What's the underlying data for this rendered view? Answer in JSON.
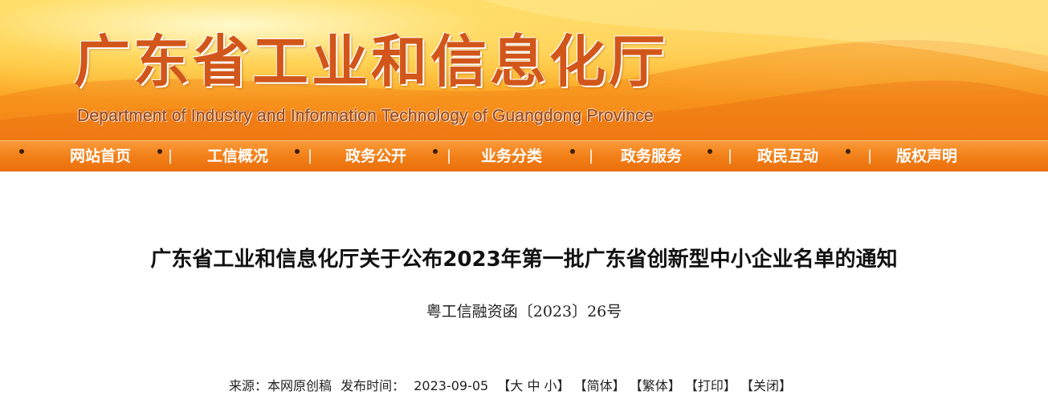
{
  "header": {
    "title_cn": "广东省工业和信息化厅",
    "title_en": "Department of Industry and Information Technology of Guangdong Province"
  },
  "nav": {
    "items": [
      {
        "label": "网站首页"
      },
      {
        "label": "工信概况"
      },
      {
        "label": "政务公开"
      },
      {
        "label": "业务分类"
      },
      {
        "label": "政务服务"
      },
      {
        "label": "政民互动"
      },
      {
        "label": "版权声明"
      }
    ],
    "separator": "|"
  },
  "article": {
    "title": "广东省工业和信息化厅关于公布2023年第一批广东省创新型中小企业名单的通知",
    "doc_number": "粤工信融资函〔2023〕26号",
    "meta": {
      "source_label": "来源：",
      "source_value": "本网原创稿",
      "date_label": "发布时间：",
      "date_value": "2023-09-05",
      "font_size": {
        "open": "【",
        "large": "大",
        "medium": "中",
        "small": "小",
        "close": "】"
      },
      "simplified": "【简体】",
      "traditional": "【繁体】",
      "print": "【打印】",
      "close": "【关闭】"
    }
  },
  "colors": {
    "banner_orange": "#f7931b",
    "nav_orange": "#f27e16",
    "title_red": "#d2561a"
  }
}
